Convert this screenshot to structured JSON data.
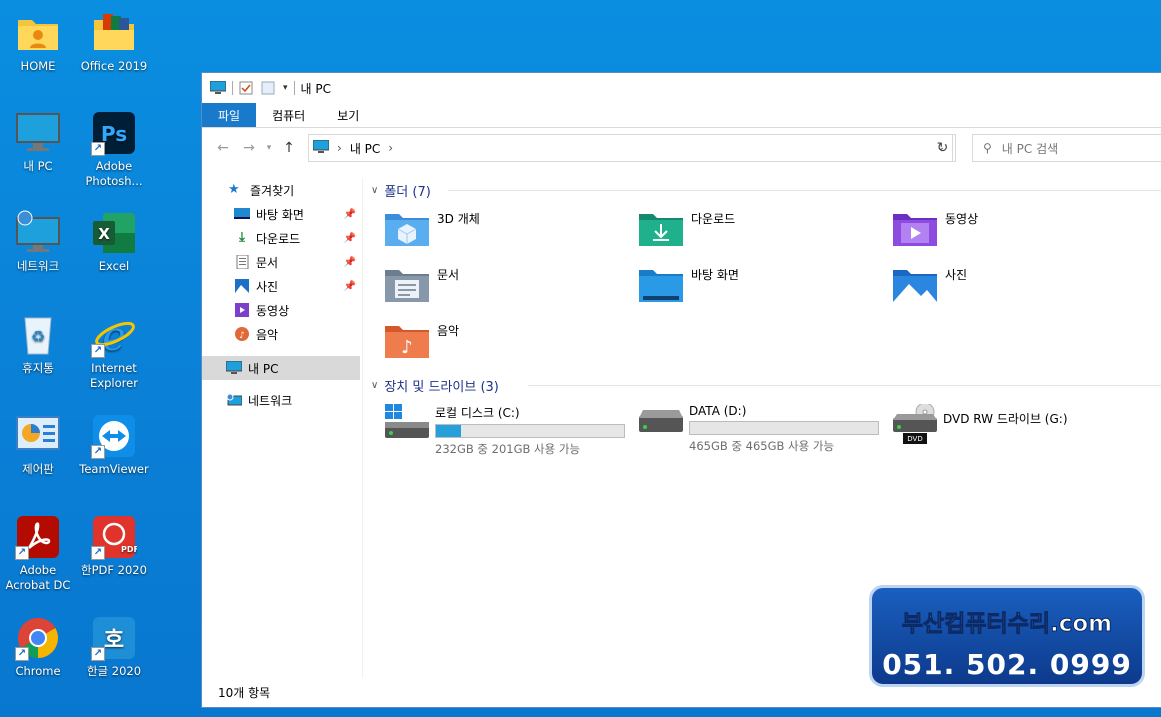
{
  "desktop": {
    "icons": [
      {
        "label": "HOME"
      },
      {
        "label": "Office 2019"
      },
      {
        "label": "내 PC"
      },
      {
        "label": "Adobe\nPhotosh..."
      },
      {
        "label": "네트워크"
      },
      {
        "label": "Excel"
      },
      {
        "label": "휴지통"
      },
      {
        "label": "Internet\nExplorer"
      },
      {
        "label": "제어판"
      },
      {
        "label": "TeamViewer"
      },
      {
        "label": "Adobe\nAcrobat DC"
      },
      {
        "label": "한PDF 2020"
      },
      {
        "label": "Chrome"
      },
      {
        "label": "한글 2020"
      }
    ]
  },
  "window": {
    "title": "내 PC",
    "ribbon_tabs": [
      "파일",
      "컴퓨터",
      "보기"
    ],
    "address_path": "내 PC",
    "search_placeholder": "내 PC 검색",
    "status": "10개 항목"
  },
  "sidebar": {
    "quick_access": "즐겨찾기",
    "items": [
      "바탕 화면",
      "다운로드",
      "문서",
      "사진",
      "동영상",
      "음악"
    ],
    "this_pc": "내 PC",
    "network": "네트워크"
  },
  "folders": {
    "header": "폴더 (7)",
    "items": [
      "3D 개체",
      "다운로드",
      "동영상",
      "문서",
      "바탕 화면",
      "사진",
      "음악"
    ]
  },
  "drives": {
    "header": "장치 및 드라이브 (3)",
    "items": [
      {
        "name": "로컬 디스크 (C:)",
        "space": "232GB 중 201GB 사용 가능",
        "used_fraction": 0.134
      },
      {
        "name": "DATA (D:)",
        "space": "465GB 중 465GB 사용 가능",
        "used_fraction": 0.0
      },
      {
        "name": "DVD RW 드라이브 (G:)",
        "badge": "DVD"
      }
    ]
  },
  "banner": {
    "line1": "부산컴퓨터수리.com",
    "line2": "051. 502. 0999"
  },
  "colors": {
    "desktop": "#0a8ee0",
    "ribbon_file": "#1979ca",
    "bar_fill": "#26a0da",
    "header_text": "#1e3287"
  }
}
